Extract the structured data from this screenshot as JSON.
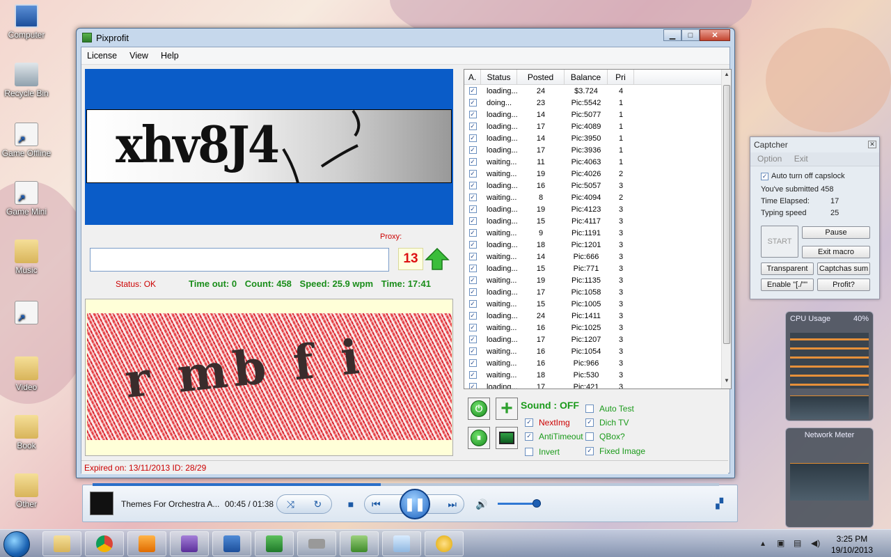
{
  "desktop": {
    "icons": [
      {
        "label": "Computer",
        "kind": "pc"
      },
      {
        "label": "Recycle Bin",
        "kind": "bin"
      },
      {
        "label": "Game Offline",
        "kind": "shortcut"
      },
      {
        "label": "Game Mini",
        "kind": "shortcut"
      },
      {
        "label": "Music",
        "kind": "folder"
      },
      {
        "label": "",
        "kind": "shortcut"
      },
      {
        "label": "Video",
        "kind": "folder"
      },
      {
        "label": "Book",
        "kind": "folder"
      },
      {
        "label": "Other",
        "kind": "folder"
      }
    ]
  },
  "window": {
    "title": "Pixprofit",
    "menu": [
      "License",
      "View",
      "Help"
    ],
    "captcha_top_text": "xhv8J4",
    "proxy_label": "Proxy:",
    "answer_value": "",
    "counter": "13",
    "status": "Status: OK",
    "stats": {
      "timeout": "Time out: 0",
      "count": "Count: 458",
      "speed": "Speed: 25.9 wpm",
      "time": "Time: 17:41"
    },
    "captcha_bottom_text": "r mb f i",
    "footer": "Expired on: 13/11/2013   ID: 28/29",
    "grid": {
      "columns": [
        "A.",
        "Status",
        "Posted",
        "Balance",
        "Pri"
      ],
      "rows": [
        [
          "loading...",
          "24",
          "$3.724",
          "4"
        ],
        [
          "doing...",
          "23",
          "Pic:5542",
          "1"
        ],
        [
          "loading...",
          "14",
          "Pic:5077",
          "1"
        ],
        [
          "loading...",
          "17",
          "Pic:4089",
          "1"
        ],
        [
          "loading...",
          "14",
          "Pic:3950",
          "1"
        ],
        [
          "loading...",
          "17",
          "Pic:3936",
          "1"
        ],
        [
          "waiting...",
          "11",
          "Pic:4063",
          "1"
        ],
        [
          "waiting...",
          "19",
          "Pic:4026",
          "2"
        ],
        [
          "loading...",
          "16",
          "Pic:5057",
          "3"
        ],
        [
          "waiting...",
          "8",
          "Pic:4094",
          "2"
        ],
        [
          "loading...",
          "19",
          "Pic:4123",
          "3"
        ],
        [
          "loading...",
          "15",
          "Pic:4117",
          "3"
        ],
        [
          "waiting...",
          "9",
          "Pic:1191",
          "3"
        ],
        [
          "loading...",
          "18",
          "Pic:1201",
          "3"
        ],
        [
          "waiting...",
          "14",
          "Pic:666",
          "3"
        ],
        [
          "loading...",
          "15",
          "Pic:771",
          "3"
        ],
        [
          "waiting...",
          "19",
          "Pic:1135",
          "3"
        ],
        [
          "loading...",
          "17",
          "Pic:1058",
          "3"
        ],
        [
          "waiting...",
          "15",
          "Pic:1005",
          "3"
        ],
        [
          "loading...",
          "24",
          "Pic:1411",
          "3"
        ],
        [
          "waiting...",
          "16",
          "Pic:1025",
          "3"
        ],
        [
          "loading...",
          "17",
          "Pic:1207",
          "3"
        ],
        [
          "waiting...",
          "16",
          "Pic:1054",
          "3"
        ],
        [
          "waiting...",
          "16",
          "Pic:966",
          "3"
        ],
        [
          "waiting...",
          "18",
          "Pic:530",
          "3"
        ],
        [
          "loading...",
          "17",
          "Pic:421",
          "3"
        ]
      ]
    },
    "controls": {
      "sound": "Sound : OFF",
      "options": [
        {
          "label": "NextImg",
          "checked": true,
          "color": "red"
        },
        {
          "label": "AntiTimeout",
          "checked": true,
          "color": "green"
        },
        {
          "label": "Invert",
          "checked": false,
          "color": "green"
        },
        {
          "label": "Auto Test",
          "checked": false,
          "color": "green"
        },
        {
          "label": "Dich TV",
          "checked": true,
          "color": "green"
        },
        {
          "label": "QBox?",
          "checked": false,
          "color": "green"
        },
        {
          "label": "Fixed Image",
          "checked": true,
          "color": "green"
        }
      ]
    }
  },
  "media": {
    "title": "Themes For Orchestra A...",
    "time": "00:45 / 01:38",
    "progress": 0.46,
    "volume": 0.9
  },
  "captcher": {
    "title": "Captcher",
    "menu": [
      "Option",
      "Exit"
    ],
    "auto_caps": "Auto turn off capslock",
    "submitted": "You've submitted 458",
    "elapsed_label": "Time Elapsed:",
    "elapsed_value": "17",
    "speed_label": "Typing speed",
    "speed_value": "25",
    "buttons": {
      "start": "START",
      "pause": "Pause",
      "exit_macro": "Exit macro",
      "transparent": "Transparent",
      "captchas_sum": "Captchas sum",
      "enable": "Enable \"[./\"\"",
      "profit": "Profit?"
    }
  },
  "gadgets": {
    "cpu_title": "CPU Usage",
    "cpu_value": "40%",
    "net_title": "Network Meter"
  },
  "taskbar": {
    "time": "3:25 PM",
    "date": "19/10/2013"
  },
  "colors": {
    "stats_green": "#1a8d1a",
    "status_red": "#cc0000",
    "captcha_blue": "#0a5cc8"
  }
}
